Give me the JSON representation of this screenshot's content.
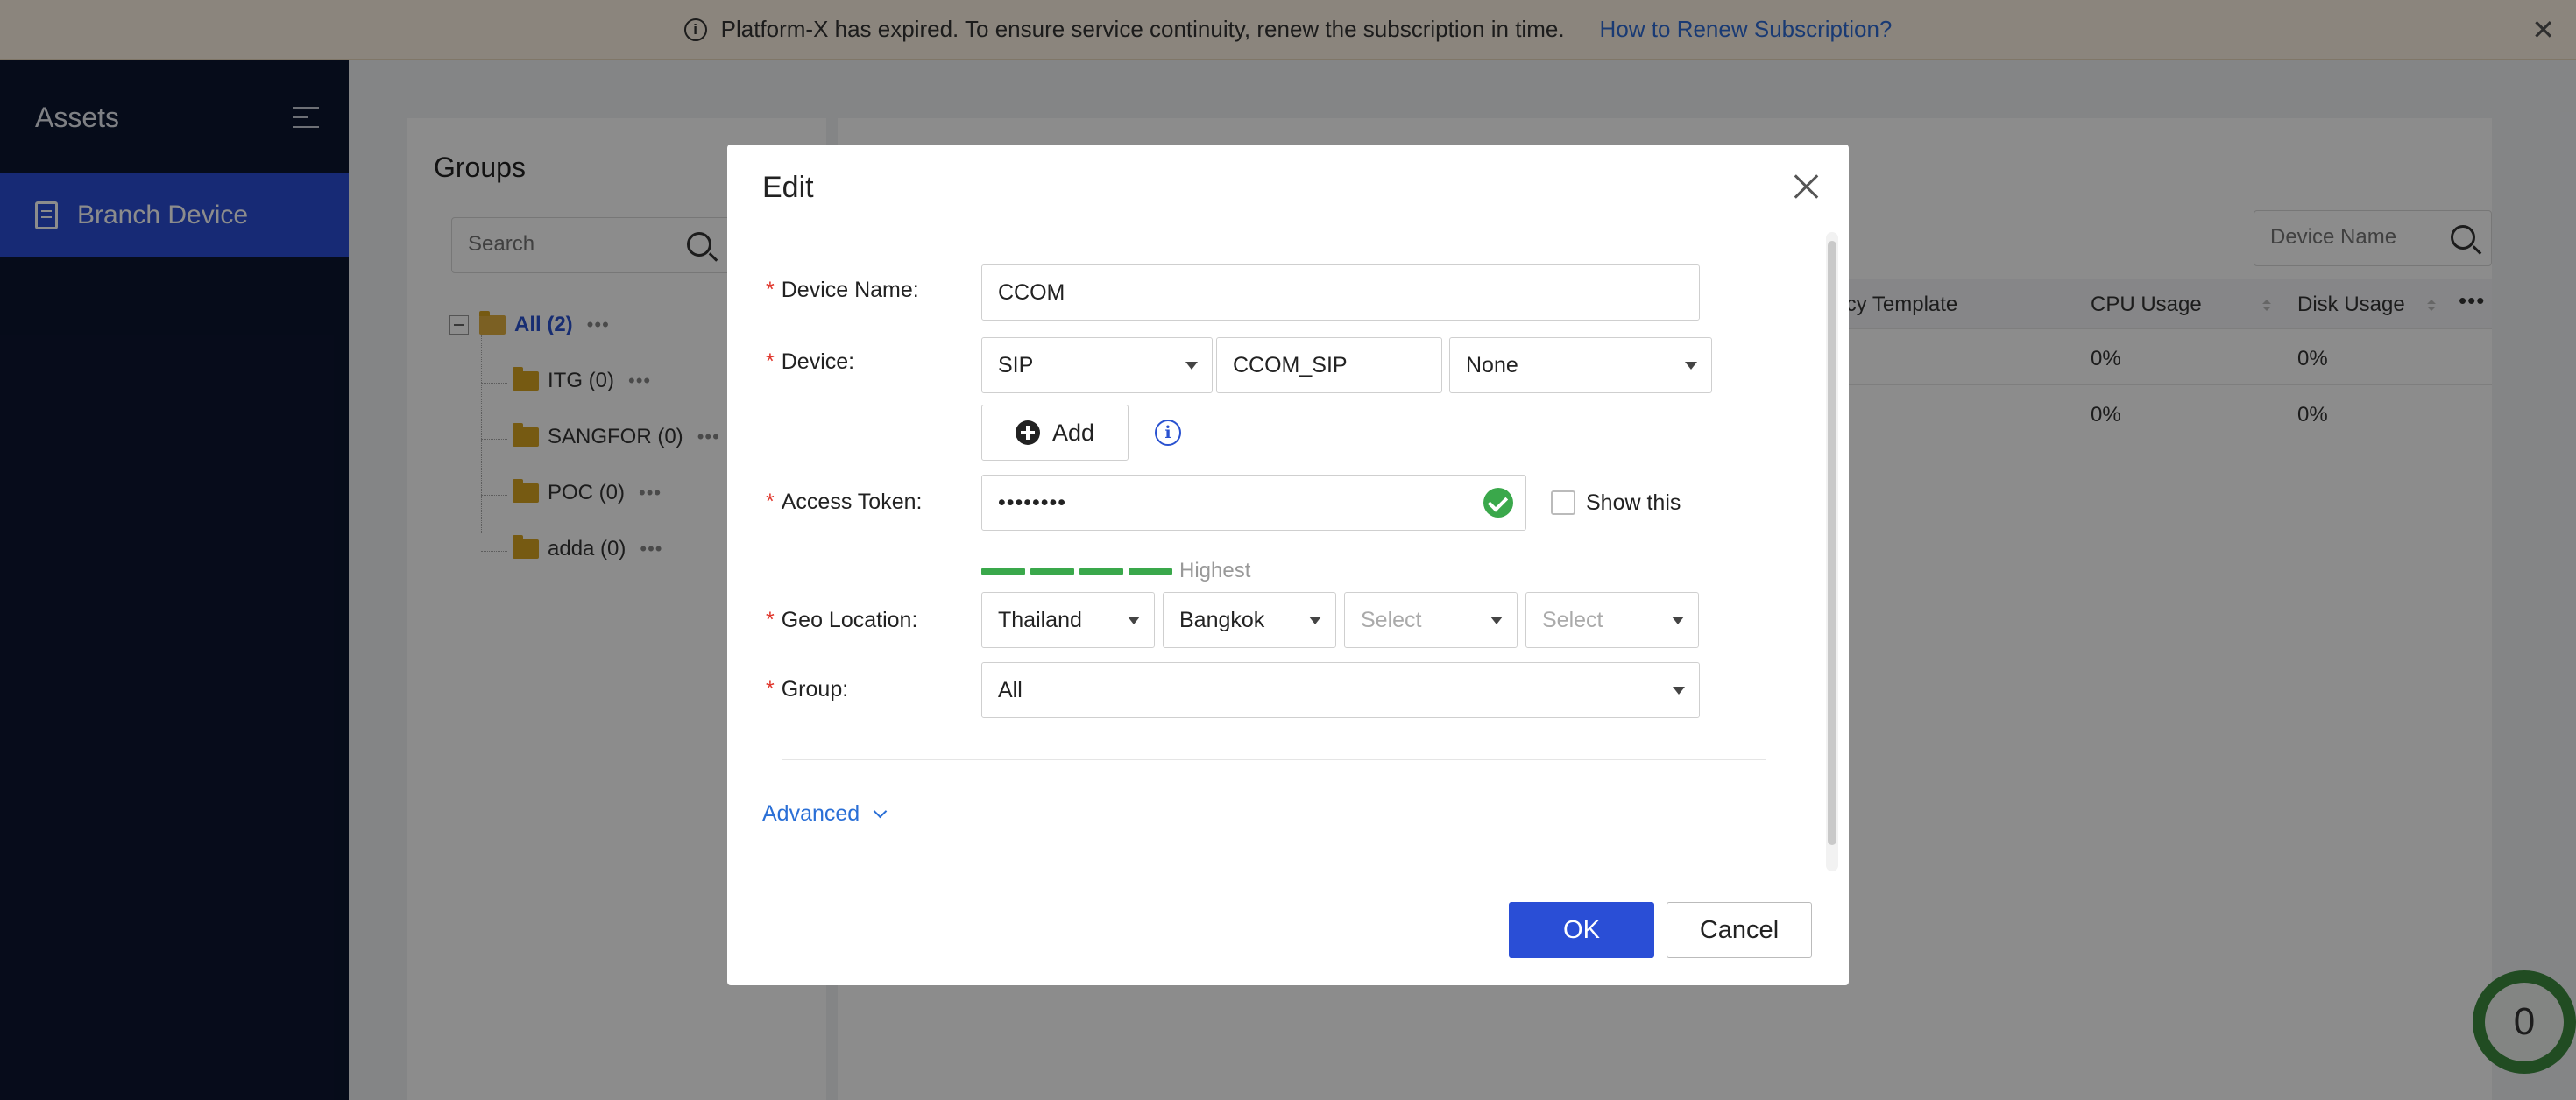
{
  "banner": {
    "message": "Platform-X has expired. To ensure service continuity, renew the subscription in time.",
    "link": "How to Renew Subscription?"
  },
  "sidebar": {
    "title": "Assets",
    "items": [
      {
        "label": "Branch Device"
      }
    ]
  },
  "groups": {
    "title": "Groups",
    "search_placeholder": "Search",
    "root": {
      "label": "All (2)"
    },
    "children": [
      {
        "label": "ITG (0)"
      },
      {
        "label": "SANGFOR (0)"
      },
      {
        "label": "POC (0)"
      },
      {
        "label": "adda (0)"
      }
    ]
  },
  "device_list": {
    "search_placeholder": "Device Name",
    "columns": [
      "licy Template",
      "CPU Usage",
      "Disk Usage"
    ],
    "rows": [
      {
        "cpu": "0%",
        "disk": "0%"
      },
      {
        "cpu": "0%",
        "disk": "0%"
      }
    ]
  },
  "modal": {
    "title": "Edit",
    "device_name_label": "Device Name:",
    "device_name_value": "CCOM",
    "device_label": "Device:",
    "device_type": "SIP",
    "device_id": "CCOM_SIP",
    "device_option": "None",
    "add_label": "Add",
    "access_token_label": "Access Token:",
    "access_token_value": "••••••••",
    "show_this_label": "Show this",
    "strength_label": "Highest",
    "geo_label": "Geo Location:",
    "geo_country": "Thailand",
    "geo_city": "Bangkok",
    "geo_select_1": "Select",
    "geo_select_2": "Select",
    "group_label": "Group:",
    "group_value": "All",
    "advanced_label": "Advanced",
    "ok_label": "OK",
    "cancel_label": "Cancel"
  },
  "float_badge": {
    "count": "0"
  },
  "colors": {
    "primary": "#2a4ed6",
    "sidebar_bg": "#0c1631",
    "success": "#3aa84b",
    "link": "#2a6fd6",
    "required": "#e0362c"
  }
}
